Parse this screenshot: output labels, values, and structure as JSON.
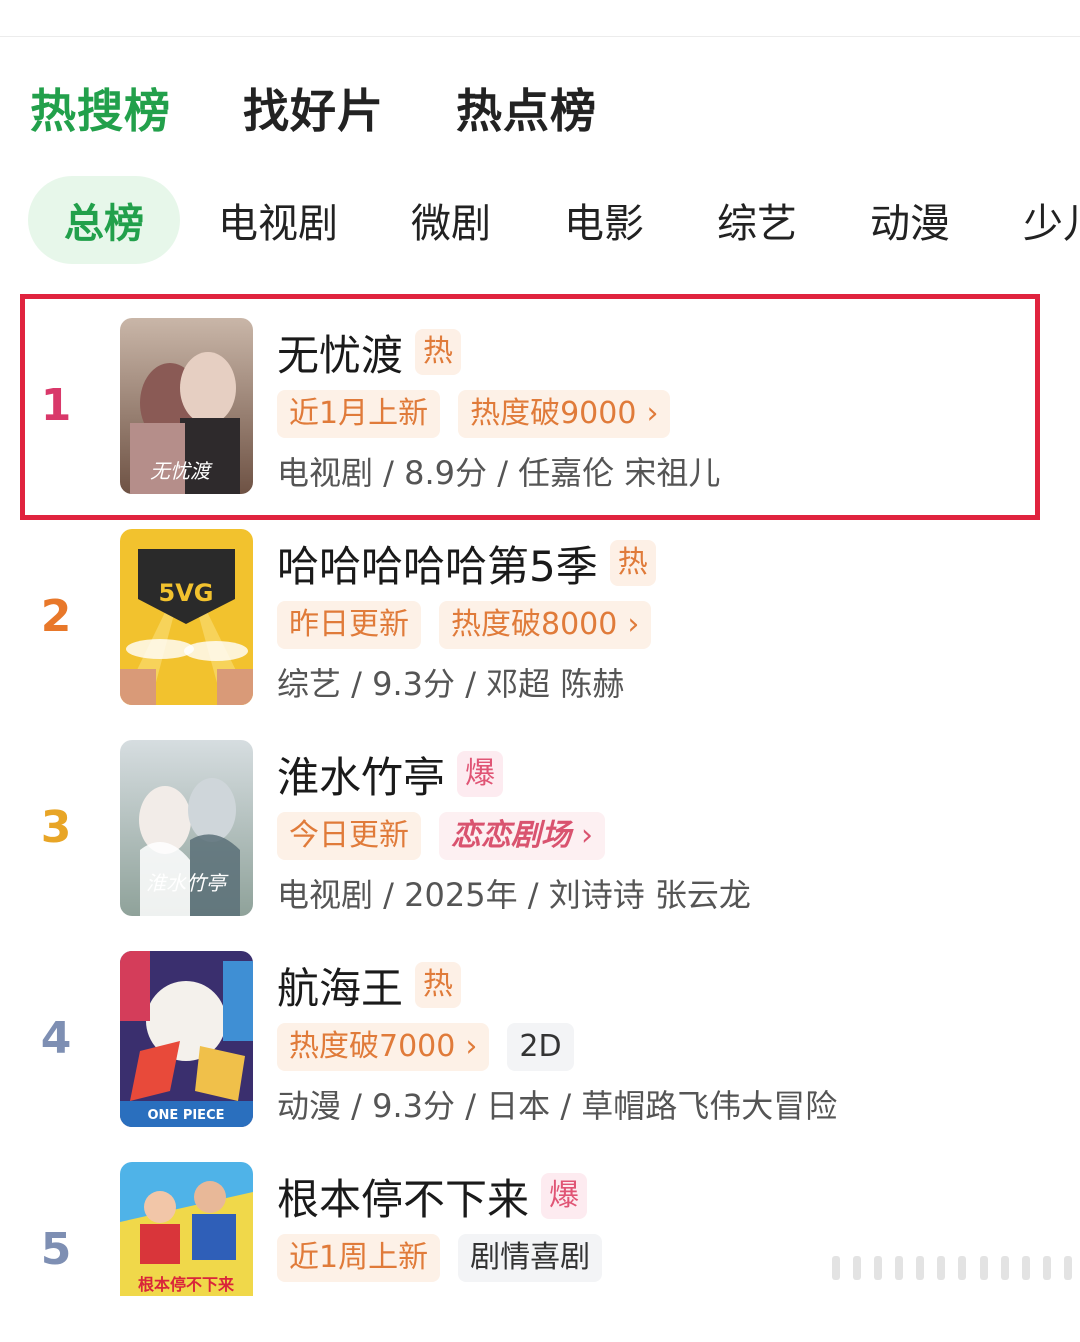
{
  "main_tabs": [
    {
      "label": "热搜榜",
      "active": true
    },
    {
      "label": "找好片",
      "active": false
    },
    {
      "label": "热点榜",
      "active": false
    }
  ],
  "sub_tabs": [
    {
      "label": "总榜",
      "active": true
    },
    {
      "label": "电视剧",
      "active": false
    },
    {
      "label": "微剧",
      "active": false
    },
    {
      "label": "电影",
      "active": false
    },
    {
      "label": "综艺",
      "active": false
    },
    {
      "label": "动漫",
      "active": false
    },
    {
      "label": "少儿",
      "active": false
    }
  ],
  "chevron": "›",
  "items": [
    {
      "rank": "1",
      "title": "无忧渡",
      "badge": "热",
      "tags": [
        "近1月上新",
        "热度破9000"
      ],
      "info": "电视剧 / 8.9分 / 任嘉伦 宋祖儿",
      "poster_text": "无忧渡"
    },
    {
      "rank": "2",
      "title": "哈哈哈哈哈第5季",
      "badge": "热",
      "tags": [
        "昨日更新",
        "热度破8000"
      ],
      "info": "综艺 / 9.3分 / 邓超 陈赫",
      "poster_text": "5VG"
    },
    {
      "rank": "3",
      "title": "淮水竹亭",
      "badge": "爆",
      "tags": [
        "今日更新",
        "恋恋剧场"
      ],
      "info": "电视剧 / 2025年 / 刘诗诗 张云龙",
      "poster_text": "淮水竹亭"
    },
    {
      "rank": "4",
      "title": "航海王",
      "badge": "热",
      "tags": [
        "热度破7000",
        "2D"
      ],
      "info": "动漫 / 9.3分 / 日本 / 草帽路飞伟大冒险",
      "poster_text": "ONE PIECE"
    },
    {
      "rank": "5",
      "title": "根本停不下来",
      "badge": "爆",
      "tags": [
        "近1周上新",
        "剧情喜剧"
      ],
      "info": "",
      "poster_text": "根本停不下来"
    }
  ],
  "colors": {
    "accent_green": "#22a04b",
    "rank1": "#d9386a",
    "rank2": "#e8782a",
    "rank3": "#e8a526",
    "rank_other": "#7e8fb3",
    "highlight": "#e0233e"
  }
}
